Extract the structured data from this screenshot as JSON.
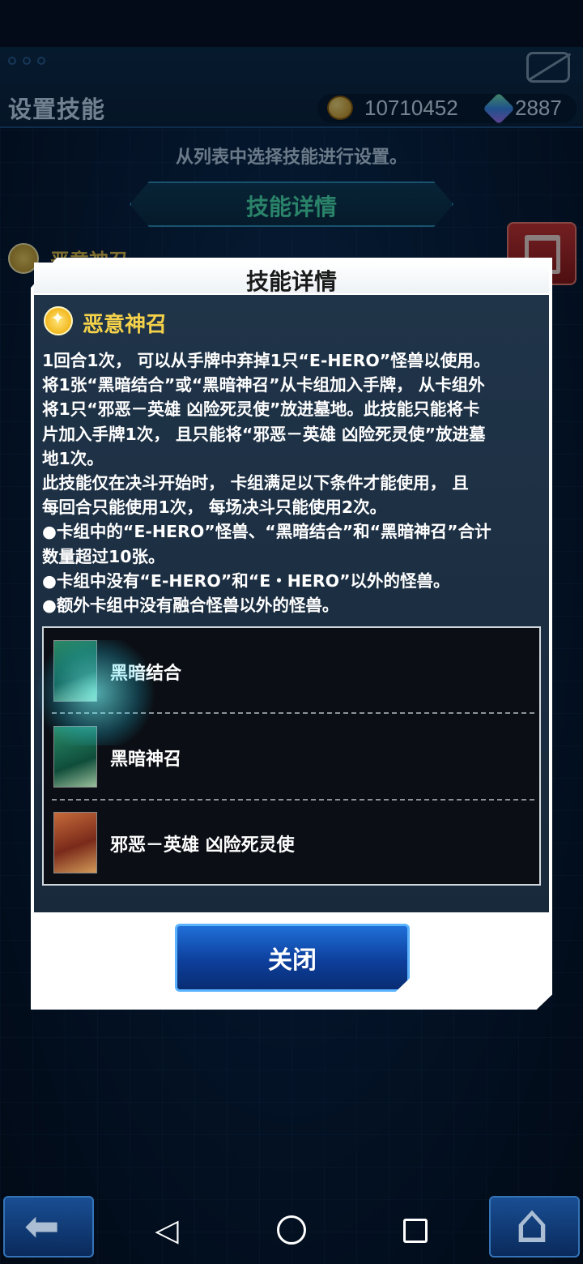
{
  "header": {
    "title": "设置技能",
    "coins": "10710452",
    "gems": "2887"
  },
  "instruction": "从列表中选择技能进行设置。",
  "section_header": "技能详情",
  "background_skill_name": "恶意神召",
  "modal": {
    "title": "技能详情",
    "skill_name": "恶意神召",
    "description": [
      "1回合1次， 可以从手牌中弃掉1只“E-HERO”怪兽以使用。",
      "将1张“黑暗结合”或“黑暗神召”从卡组加入手牌， 从卡组外",
      "将1只“邪恶－英雄 凶险死灵使”放进墓地。此技能只能将卡",
      "片加入手牌1次， 且只能将“邪恶－英雄 凶险死灵使”放进墓",
      "地1次。",
      "此技能仅在决斗开始时， 卡组满足以下条件才能使用， 且",
      "每回合只能使用1次， 每场决斗只能使用2次。",
      "●卡组中的“E-HERO”怪兽、“黑暗结合”和“黑暗神召”合计",
      "数量超过10张。",
      "●卡组中没有“E-HERO”和“E・HERO”以外的怪兽。",
      "●额外卡组中没有融合怪兽以外的怪兽。"
    ],
    "cards": [
      {
        "name": "黑暗结合"
      },
      {
        "name": "黑暗神召"
      },
      {
        "name": "邪恶－英雄 凶险死灵使"
      }
    ],
    "close_label": "关闭"
  },
  "icons": {
    "coin": "coin-icon",
    "gem": "gem-icon",
    "skill": "skill-star-icon",
    "trash": "trash-icon",
    "back": "back-arrow-icon",
    "home": "home-icon"
  }
}
